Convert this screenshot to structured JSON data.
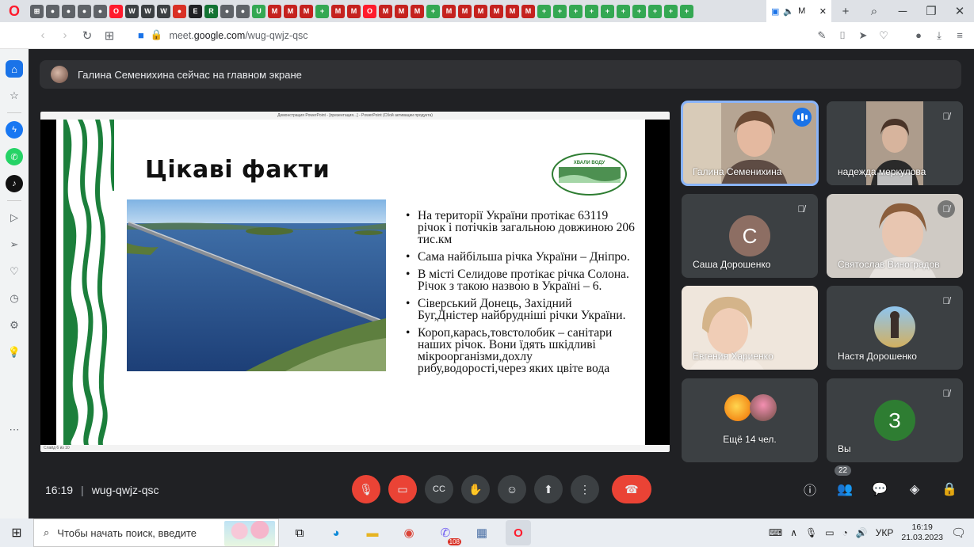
{
  "browser": {
    "active_tab_label": "M",
    "url_prefix": "meet.",
    "url_domain": "google.com",
    "url_path": "/wug-qwjz-qsc",
    "mini_tabs": [
      {
        "color": "#5f6368",
        "glyph": "⊞"
      },
      {
        "color": "#5f6368",
        "glyph": "●"
      },
      {
        "color": "#5f6368",
        "glyph": "●"
      },
      {
        "color": "#5f6368",
        "glyph": "●"
      },
      {
        "color": "#5f6368",
        "glyph": "●"
      },
      {
        "color": "#ff1b2d",
        "glyph": "O"
      },
      {
        "color": "#3c4043",
        "glyph": "W"
      },
      {
        "color": "#3c4043",
        "glyph": "W"
      },
      {
        "color": "#3c4043",
        "glyph": "W"
      },
      {
        "color": "#d93025",
        "glyph": "●"
      },
      {
        "color": "#202124",
        "glyph": "E"
      },
      {
        "color": "#137333",
        "glyph": "R"
      },
      {
        "color": "#5f6368",
        "glyph": "●"
      },
      {
        "color": "#5f6368",
        "glyph": "●"
      },
      {
        "color": "#34a853",
        "glyph": "U"
      },
      {
        "color": "#c5221f",
        "glyph": "M"
      },
      {
        "color": "#c5221f",
        "glyph": "M"
      },
      {
        "color": "#c5221f",
        "glyph": "M"
      },
      {
        "color": "#34a853",
        "glyph": "+"
      },
      {
        "color": "#c5221f",
        "glyph": "M"
      },
      {
        "color": "#c5221f",
        "glyph": "M"
      },
      {
        "color": "#ff1b2d",
        "glyph": "O"
      },
      {
        "color": "#c5221f",
        "glyph": "M"
      },
      {
        "color": "#c5221f",
        "glyph": "M"
      },
      {
        "color": "#c5221f",
        "glyph": "M"
      },
      {
        "color": "#34a853",
        "glyph": "+"
      },
      {
        "color": "#c5221f",
        "glyph": "M"
      },
      {
        "color": "#c5221f",
        "glyph": "M"
      },
      {
        "color": "#c5221f",
        "glyph": "M"
      },
      {
        "color": "#c5221f",
        "glyph": "M"
      },
      {
        "color": "#c5221f",
        "glyph": "M"
      },
      {
        "color": "#c5221f",
        "glyph": "M"
      },
      {
        "color": "#34a853",
        "glyph": "+"
      },
      {
        "color": "#34a853",
        "glyph": "+"
      },
      {
        "color": "#34a853",
        "glyph": "+"
      },
      {
        "color": "#34a853",
        "glyph": "+"
      },
      {
        "color": "#34a853",
        "glyph": "+"
      },
      {
        "color": "#34a853",
        "glyph": "+"
      },
      {
        "color": "#34a853",
        "glyph": "+"
      },
      {
        "color": "#34a853",
        "glyph": "+"
      },
      {
        "color": "#34a853",
        "glyph": "+"
      },
      {
        "color": "#34a853",
        "glyph": "+"
      }
    ]
  },
  "meet": {
    "banner_text": "Галина Семенихина сейчас на главном экране",
    "time": "16:19",
    "meeting_code": "wug-qwjz-qsc",
    "participants_count": "22",
    "more_label": "Ещё 14 чел."
  },
  "slide": {
    "window_title": "Демонстрация PowerPoint - [презентация...] - PowerPoint (Сбой активации продукта)",
    "status_text": "Слайд 6 из 10",
    "title": "Цікаві факти",
    "logo_text": "ХВАЛИ ВОДУ",
    "bullets": [
      "На території України протікає 63119 річок і потічків загальною довжиною 206 тис.км",
      "Сама найбільша річка України – Дніпро.",
      "В місті Селидове протікає річка Солона. Річок з такою назвою в Україні – 6.",
      "Сіверський Донець, Західний Буг,Дністер  найбрудніші річки України.",
      " Короп,карась,товстолобик – санітари наших річок. Вони їдять шкідливі мікроорганізми,дохлу рибу,водорості,через яких цвіте вода"
    ]
  },
  "participants": [
    {
      "name": "Галина Семенихина",
      "type": "video",
      "speaking": true
    },
    {
      "name": "надежда меркулова",
      "type": "video",
      "muted": true
    },
    {
      "name": "Саша Дорошенко",
      "type": "letter",
      "letter": "С",
      "color": "#8d6e63",
      "muted": true
    },
    {
      "name": "Святослав Виноградов",
      "type": "video",
      "muted": true
    },
    {
      "name": "Евгения Хариенко",
      "type": "video"
    },
    {
      "name": "Настя Дорошенко",
      "type": "avatar",
      "muted": true
    },
    {
      "name": "Вы",
      "type": "letter",
      "letter": "З",
      "color": "#2e7d32",
      "muted": true
    }
  ],
  "taskbar": {
    "search_placeholder": "Чтобы начать поиск, введите",
    "lang": "УКР",
    "clock_time": "16:19",
    "clock_date": "21.03.2023",
    "viber_badge": "108"
  }
}
